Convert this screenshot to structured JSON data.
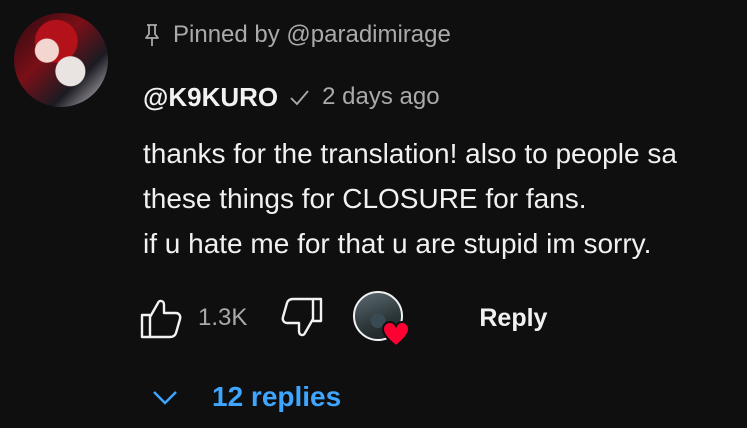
{
  "comment": {
    "pinned_text": "Pinned by @paradimirage",
    "author": "@K9KURO",
    "timestamp": "2 days ago",
    "lines": [
      "thanks for the translation! also to people sa",
      "these things for CLOSURE for fans.",
      "if u hate me for that u are stupid im sorry."
    ]
  },
  "actions": {
    "like_count": "1.3K",
    "reply_label": "Reply"
  },
  "replies": {
    "label": "12 replies"
  },
  "colors": {
    "background": "#0f0f0f",
    "text": "#f1f1f1",
    "muted": "#aaaaaa",
    "link": "#3ea6ff",
    "heart": "#ff0033"
  },
  "icons": [
    "pin-icon",
    "verified-check-icon",
    "thumbs-up-icon",
    "thumbs-down-icon",
    "heart-icon",
    "chevron-down-icon"
  ]
}
